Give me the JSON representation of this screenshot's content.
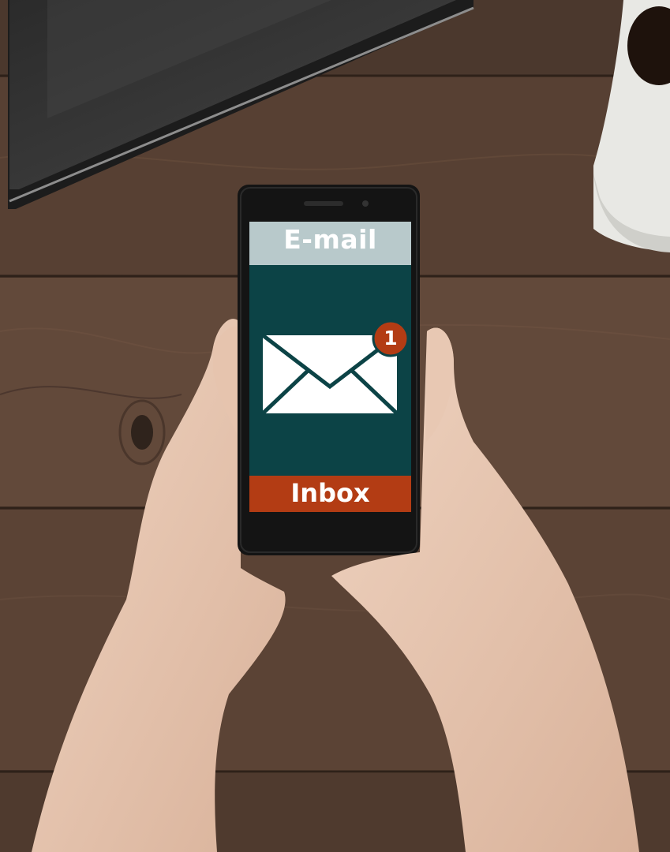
{
  "phone_screen": {
    "header_label": "E-mail",
    "footer_label": "Inbox",
    "notification_count": "1"
  },
  "icons": [
    "envelope-icon",
    "notification-badge-icon"
  ],
  "colors": {
    "wood": "#5a4234",
    "screen_header": "#b8c9cb",
    "screen_body": "#0c4346",
    "inbox_bar": "#b33c14",
    "badge": "#b33c14",
    "envelope": "#ffffff",
    "phone_body": "#141414"
  }
}
